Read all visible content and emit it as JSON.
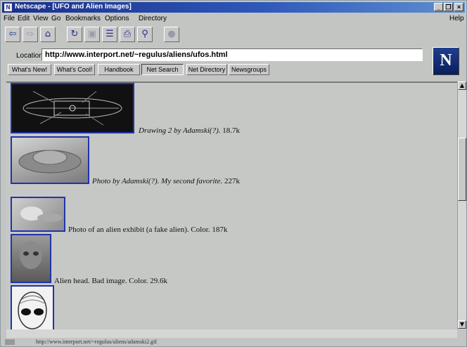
{
  "window": {
    "title": "Netscape - [UFO and Alien Images]",
    "icon_text": "N",
    "controls": [
      "_",
      "❐",
      "×"
    ]
  },
  "menubar": {
    "items": [
      "File",
      "Edit",
      "View",
      "Go",
      "Bookmarks",
      "Options",
      "Directory"
    ],
    "help": "Help"
  },
  "toolbar": {
    "icons": [
      "back-icon",
      "forward-icon",
      "home-icon",
      "reload-icon",
      "images-icon",
      "open-icon",
      "print-icon",
      "find-icon",
      "stop-icon"
    ]
  },
  "location": {
    "label": "Location:",
    "url": "http://www.interport.net/~regulus/aliens/ufos.html"
  },
  "directory_buttons": [
    "What's New!",
    "What's Cool!",
    "Handbook",
    "Net Search",
    "Net Directory",
    "Newsgroups"
  ],
  "logo": {
    "letter": "N",
    "color": "#1f3e8f"
  },
  "content": {
    "items": [
      {
        "caption": "Drawing 2 by Adamski(?).",
        "size": "18.7k",
        "italic": true
      },
      {
        "caption": "Photo by Adamski(?). My second favorite.",
        "size": "227k",
        "italic": true
      },
      {
        "caption": "Photo of an alien exhibit (a fake alien). Color.",
        "size": "187k",
        "italic": false
      },
      {
        "caption": "Alien head. Bad image. Color.",
        "size": "29.6k",
        "italic": false
      }
    ],
    "link_border_color": "#2233aa"
  },
  "status": {
    "text": "http://www.interport.net/~regulus/aliens/adamski2.gif"
  }
}
